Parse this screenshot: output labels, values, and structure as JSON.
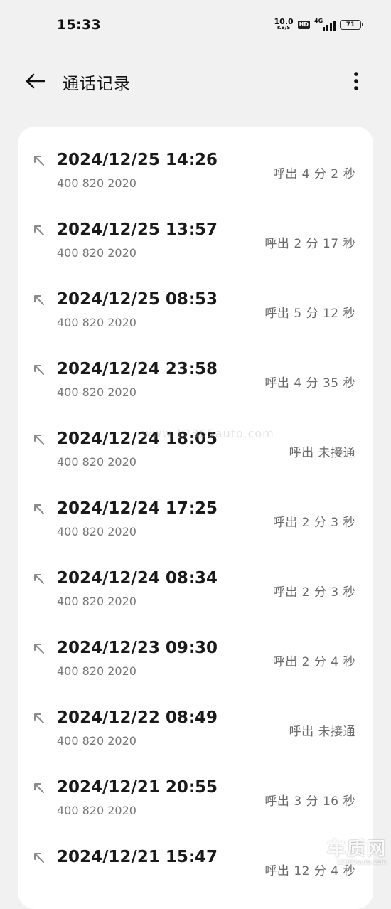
{
  "status_bar": {
    "time": "15:33",
    "net_speed_value": "10.0",
    "net_speed_unit": "KB/S",
    "hd_label": "HD",
    "network_type": "4G",
    "battery_level": "71"
  },
  "header": {
    "title": "通话记录",
    "back_icon": "arrow-left-icon",
    "more_icon": "more-vertical-icon"
  },
  "calls": [
    {
      "datetime": "2024/12/25 14:26",
      "number": "400 820 2020",
      "status": "呼出  4 分 2 秒"
    },
    {
      "datetime": "2024/12/25 13:57",
      "number": "400 820 2020",
      "status": "呼出  2 分 17 秒"
    },
    {
      "datetime": "2024/12/25 08:53",
      "number": "400 820 2020",
      "status": "呼出  5 分 12 秒"
    },
    {
      "datetime": "2024/12/24 23:58",
      "number": "400 820 2020",
      "status": "呼出  4 分 35 秒"
    },
    {
      "datetime": "2024/12/24 18:05",
      "number": "400 820 2020",
      "status": "呼出 未接通"
    },
    {
      "datetime": "2024/12/24 17:25",
      "number": "400 820 2020",
      "status": "呼出  2 分 3 秒"
    },
    {
      "datetime": "2024/12/24 08:34",
      "number": "400 820 2020",
      "status": "呼出  2 分 3 秒"
    },
    {
      "datetime": "2024/12/23 09:30",
      "number": "400 820 2020",
      "status": "呼出  2 分 4 秒"
    },
    {
      "datetime": "2024/12/22 08:49",
      "number": "400 820 2020",
      "status": "呼出 未接通"
    },
    {
      "datetime": "2024/12/21 20:55",
      "number": "400 820 2020",
      "status": "呼出  3 分 16 秒"
    },
    {
      "datetime": "2024/12/21 15:47",
      "number": "",
      "status": "呼出  12 分 4 秒"
    }
  ],
  "watermark": {
    "text": "www.12365auto.com",
    "logo_main": "车质网",
    "logo_sub": "12365auto.com"
  },
  "colors": {
    "background": "#f1f1f1",
    "card": "#ffffff",
    "primary_text": "#1a1a1a",
    "secondary_text": "#777777"
  }
}
